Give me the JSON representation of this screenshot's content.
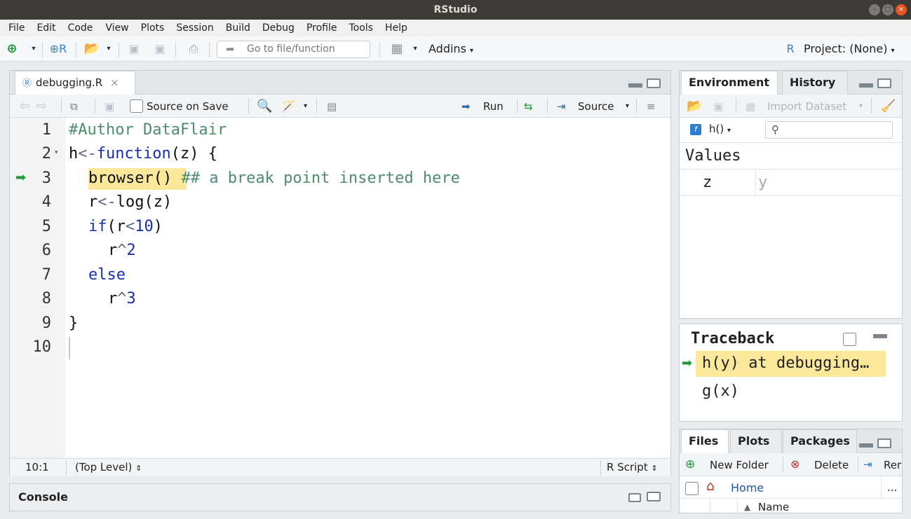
{
  "window": {
    "title": "RStudio",
    "controls": [
      "–",
      "□",
      "×"
    ]
  },
  "menu": [
    "File",
    "Edit",
    "Code",
    "View",
    "Plots",
    "Session",
    "Build",
    "Debug",
    "Profile",
    "Tools",
    "Help"
  ],
  "toolbar": {
    "goto_placeholder": "Go to file/function",
    "addins_label": "Addins",
    "project_label": "Project: (None)"
  },
  "source": {
    "tab_name": "debugging.R",
    "tab_close": "×",
    "source_on_save": "Source on Save",
    "run_label": "Run",
    "source_label": "Source",
    "lines": [
      {
        "num": "1"
      },
      {
        "num": "2"
      },
      {
        "num": "3"
      },
      {
        "num": "4"
      },
      {
        "num": "5"
      },
      {
        "num": "6"
      },
      {
        "num": "7"
      },
      {
        "num": "8"
      },
      {
        "num": "9"
      },
      {
        "num": "10"
      }
    ],
    "status_position": "10:1",
    "status_scope": "(Top Level)",
    "status_filetype": "R Script"
  },
  "code": {
    "l1": "#Author DataFlair",
    "l2a": "h",
    "l2b": "<-",
    "l2c": "function",
    "l2d": "(z) {",
    "l3a": "browser()",
    "l3b": " ## a break point inserted here",
    "l4a": "r",
    "l4b": "<-",
    "l4c": "log(z)",
    "l5a": "if",
    "l5b": "(r",
    "l5c": "<",
    "l5d": "10",
    "l5e": ")",
    "l6a": "r",
    "l6b": "^",
    "l6c": "2",
    "l7a": "else",
    "l8a": "r",
    "l8b": "^",
    "l8c": "3",
    "l9a": "}"
  },
  "console": {
    "title": "Console"
  },
  "environment": {
    "tab_environment": "Environment",
    "tab_history": "History",
    "import_dataset": "Import Dataset",
    "scope": "h()",
    "section": "Values",
    "rows": [
      {
        "name": "z",
        "value": "y"
      }
    ]
  },
  "traceback": {
    "title": "Traceback",
    "frames": [
      {
        "text": "h(y) at debugging…",
        "current": true
      },
      {
        "text": "g(x)",
        "current": false
      }
    ]
  },
  "files": {
    "tab_files": "Files",
    "tab_plots": "Plots",
    "tab_packages": "Packages",
    "new_folder": "New Folder",
    "delete": "Delete",
    "rename": "Rer",
    "home": "Home",
    "more": "...",
    "col_name": "Name"
  },
  "colors": {
    "debug_highlight": "#fbe89a",
    "green_arrow": "#1f9a3a",
    "keyword": "#1a2fb0",
    "comment": "#4d8c6f"
  }
}
